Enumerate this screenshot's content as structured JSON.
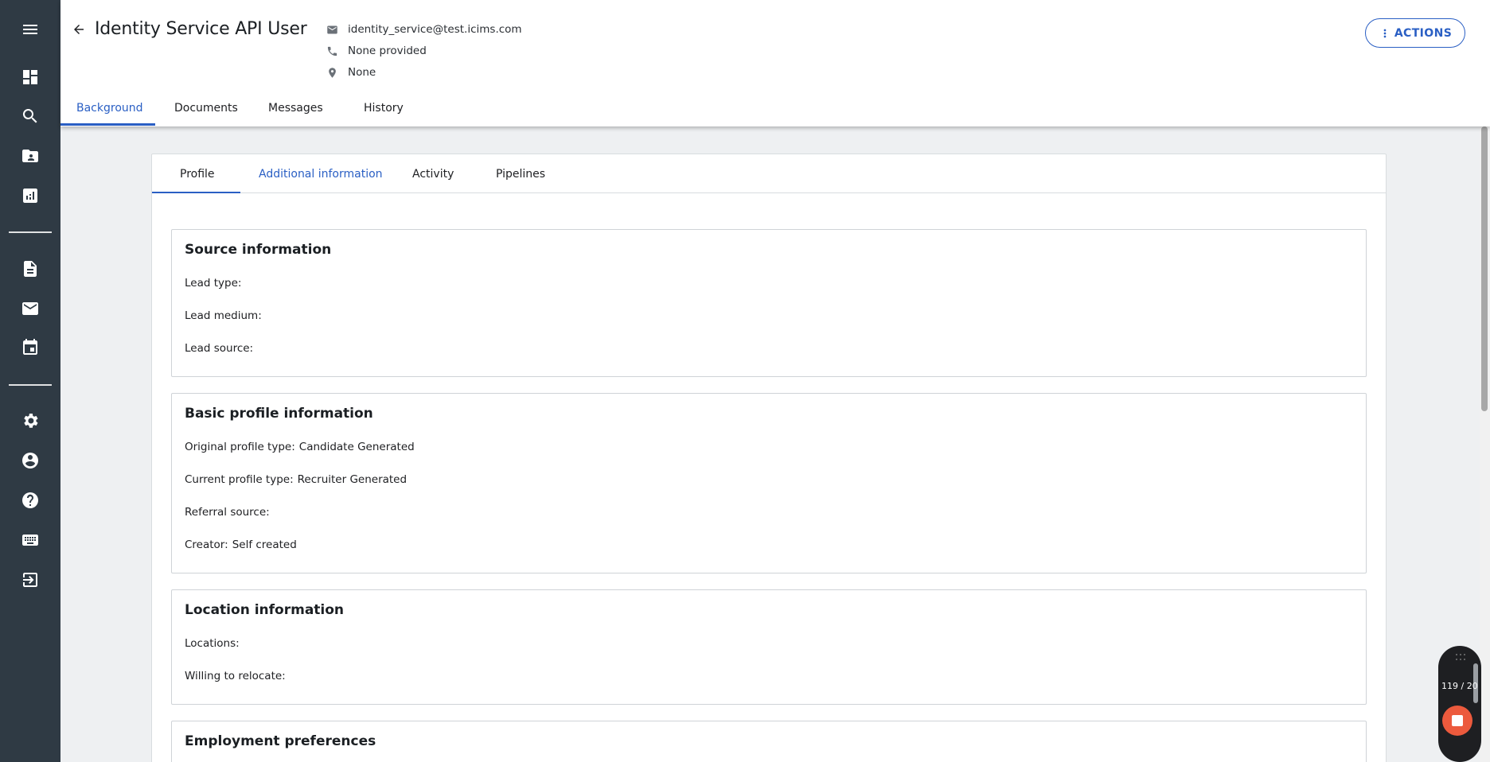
{
  "header": {
    "title": "Identity Service API User",
    "email": "identity_service@test.icims.com",
    "phone": "None provided",
    "location": "None",
    "actions_label": "ACTIONS"
  },
  "top_tabs": [
    {
      "label": "Background",
      "active": true
    },
    {
      "label": "Documents",
      "active": false
    },
    {
      "label": "Messages",
      "active": false
    },
    {
      "label": "History",
      "active": false
    }
  ],
  "sub_tabs": [
    {
      "label": "Profile",
      "active": false
    },
    {
      "label": "Additional information",
      "active": true
    },
    {
      "label": "Activity",
      "active": false
    },
    {
      "label": "Pipelines",
      "active": false
    }
  ],
  "sections": {
    "source": {
      "title": "Source information",
      "fields": [
        {
          "label": "Lead type:",
          "value": ""
        },
        {
          "label": "Lead medium:",
          "value": ""
        },
        {
          "label": "Lead source:",
          "value": ""
        }
      ]
    },
    "basic": {
      "title": "Basic profile information",
      "fields": [
        {
          "label": "Original profile type:",
          "value": "Candidate Generated"
        },
        {
          "label": "Current profile type:",
          "value": "Recruiter Generated"
        },
        {
          "label": "Referral source:",
          "value": ""
        },
        {
          "label": "Creator:",
          "value": "Self created"
        }
      ]
    },
    "location": {
      "title": "Location information",
      "fields": [
        {
          "label": "Locations:",
          "value": ""
        },
        {
          "label": "Willing to relocate:",
          "value": ""
        }
      ]
    },
    "employment": {
      "title": "Employment preferences"
    }
  },
  "rail_icons": [
    "menu-icon",
    "dashboard-icon",
    "search-icon",
    "contacts-folder-icon",
    "reports-icon",
    "document-icon",
    "mail-icon",
    "calendar-icon",
    "settings-icon",
    "account-icon",
    "help-icon",
    "keyboard-icon",
    "logout-icon"
  ],
  "widget": {
    "counter": "119 / 20"
  },
  "colors": {
    "accent": "#2a5fc4",
    "rail": "#2f3a44",
    "record": "#ec5a3d"
  }
}
